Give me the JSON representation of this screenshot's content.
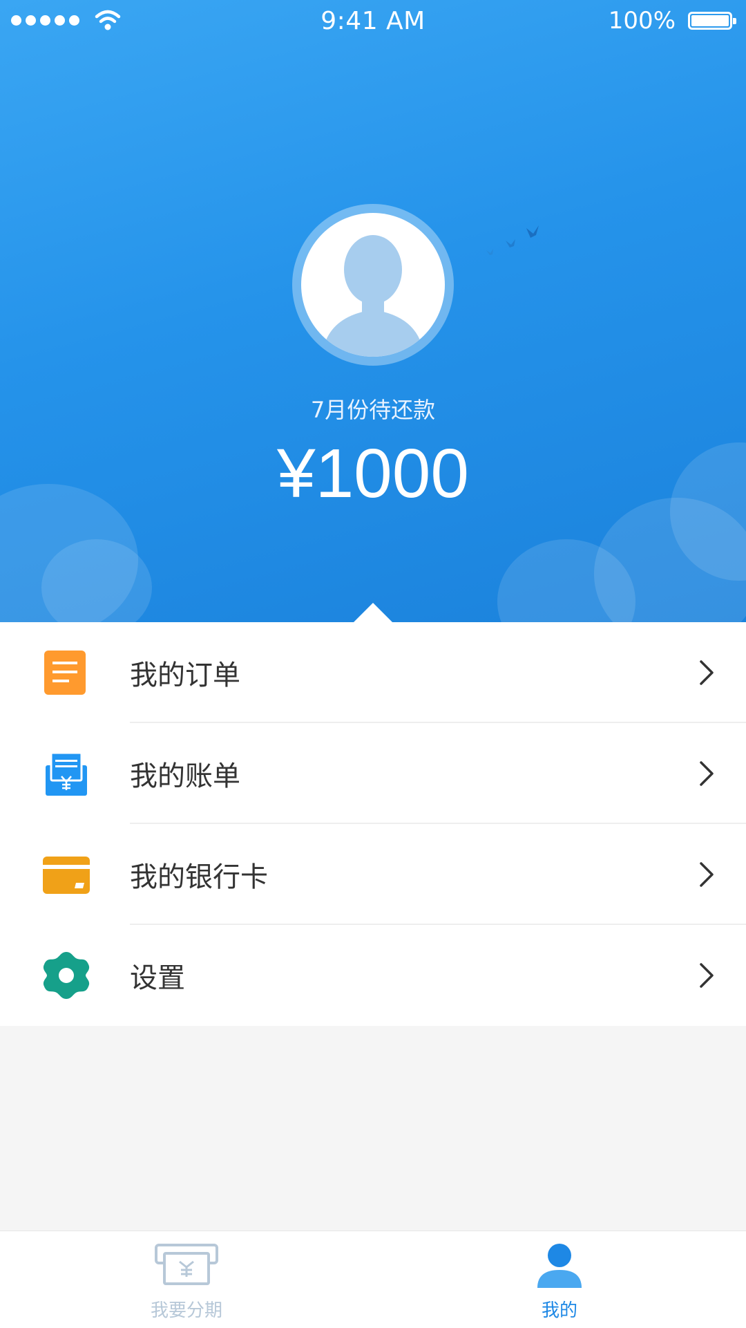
{
  "status_bar": {
    "time": "9:41 AM",
    "battery": "100%"
  },
  "header": {
    "subtitle": "7月份待还款",
    "amount": "¥1000"
  },
  "menu": {
    "items": [
      {
        "label": "我的订单",
        "icon": "order-icon",
        "color": "#ff9a2e"
      },
      {
        "label": "我的账单",
        "icon": "bill-icon",
        "color": "#2196f3"
      },
      {
        "label": "我的银行卡",
        "icon": "bank-card-icon",
        "color": "#f0a118"
      },
      {
        "label": "设置",
        "icon": "settings-gear-icon",
        "color": "#16a08a"
      }
    ]
  },
  "tabbar": {
    "tabs": [
      {
        "label": "我要分期",
        "icon": "installment-icon",
        "active": false
      },
      {
        "label": "我的",
        "icon": "profile-icon",
        "active": true
      }
    ]
  },
  "colors": {
    "header_blue": "#2593ea",
    "active_tab": "#1e88e5",
    "inactive_tab": "#b7c8d8"
  }
}
